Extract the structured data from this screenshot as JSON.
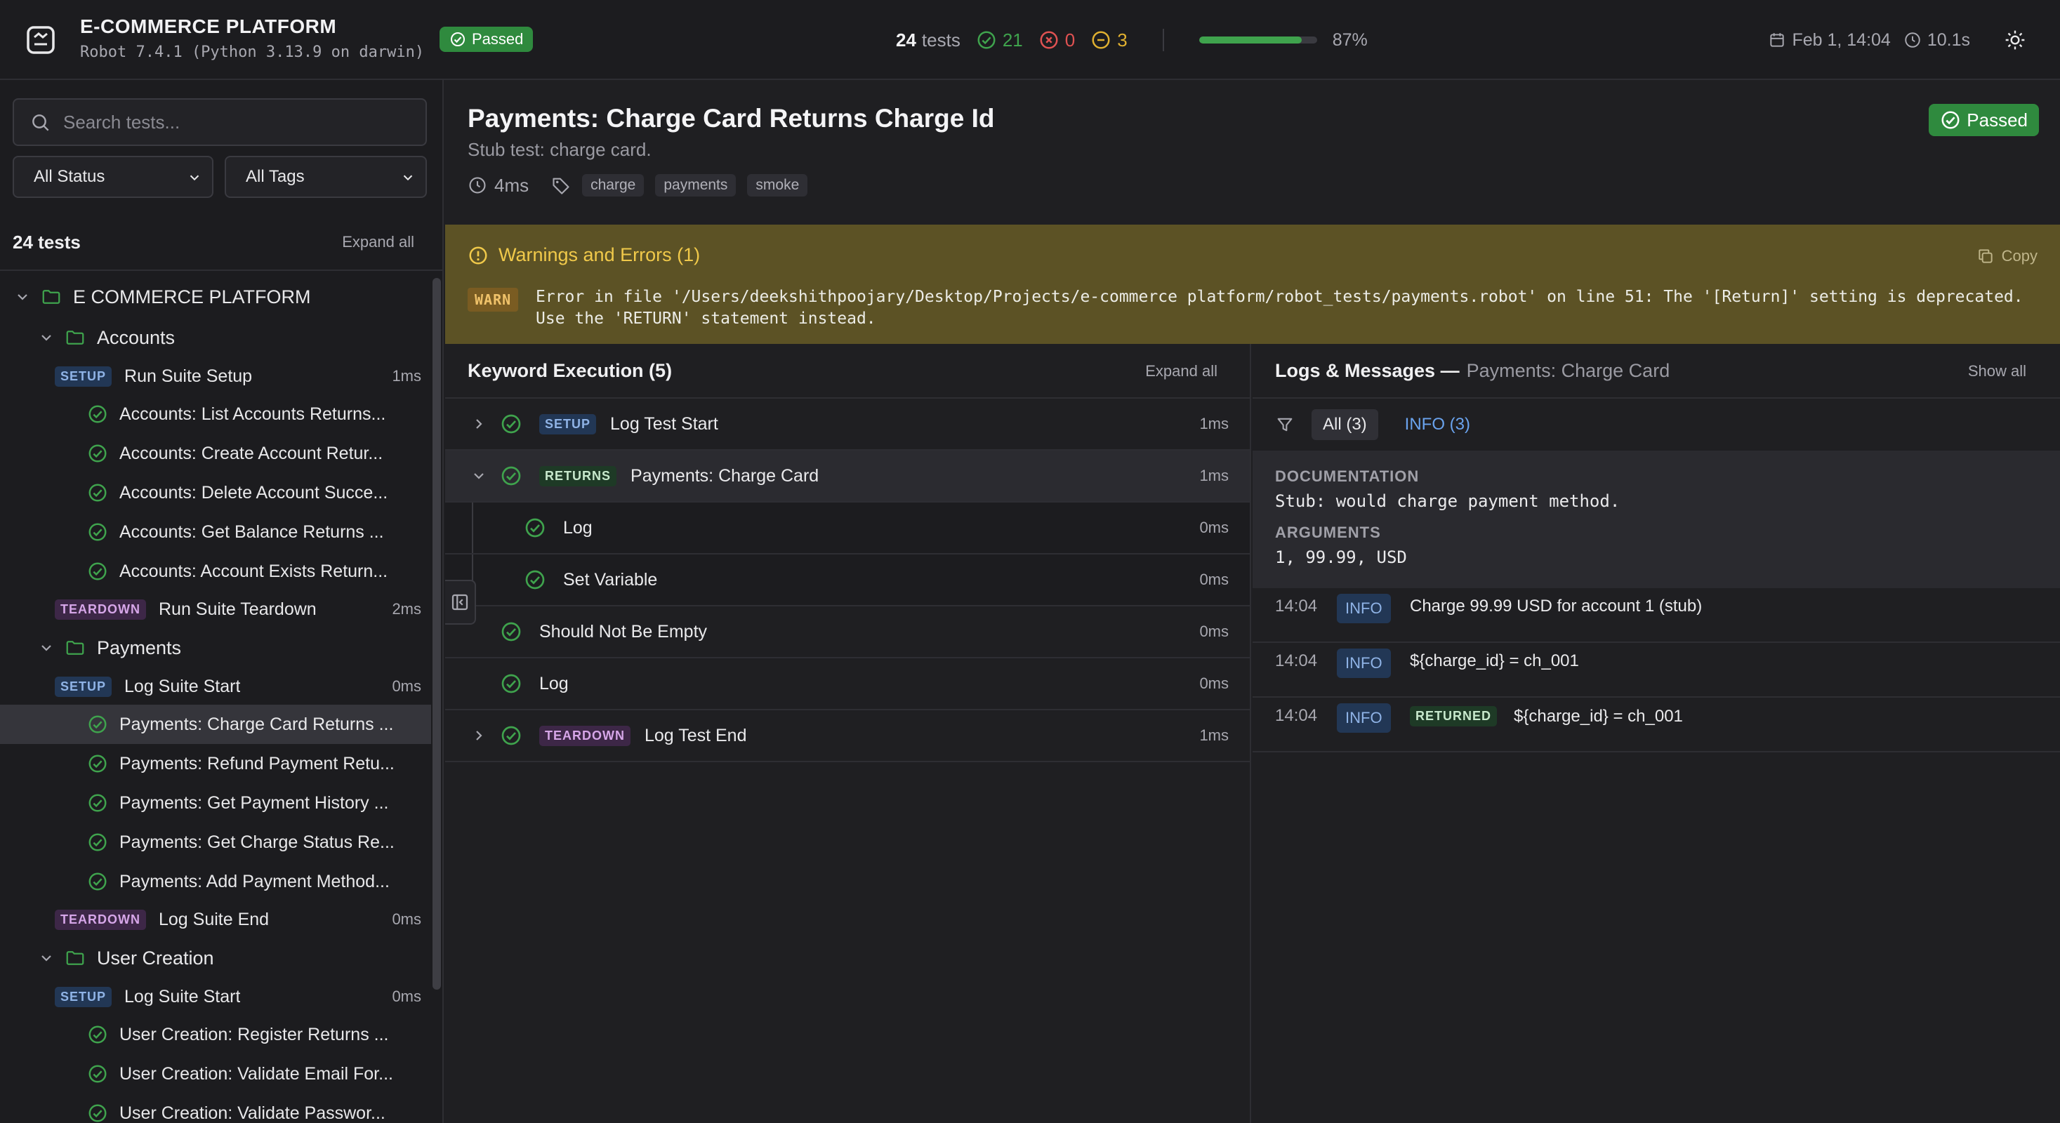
{
  "header": {
    "app_title": "E-COMMERCE PLATFORM",
    "app_subtitle": "Robot 7.4.1 (Python 3.13.9 on darwin)",
    "status": "Passed",
    "total_count": "24",
    "total_label": "tests",
    "passed": "21",
    "failed": "0",
    "skipped": "3",
    "progress_percent": 87,
    "progress_label": "87%",
    "date": "Feb 1, 14:04",
    "duration": "10.1s",
    "icons": [
      "dashboard-logo-icon",
      "check-circle-icon",
      "x-circle-icon",
      "minus-circle-icon",
      "calendar-icon",
      "clock-icon",
      "sun-icon"
    ]
  },
  "sidebar": {
    "search_placeholder": "Search tests...",
    "status_filter": "All Status",
    "tags_filter": "All Tags",
    "count_label": "24 tests",
    "expand_all": "Expand all",
    "tree": [
      {
        "kind": "suite",
        "level": 0,
        "label": "E COMMERCE PLATFORM"
      },
      {
        "kind": "suite",
        "level": 1,
        "label": "Accounts"
      },
      {
        "kind": "setup",
        "level": 2,
        "label": "Run Suite Setup",
        "duration": "1ms"
      },
      {
        "kind": "test",
        "level": 2,
        "label": "Accounts: List Accounts Returns..."
      },
      {
        "kind": "test",
        "level": 2,
        "label": "Accounts: Create Account Retur..."
      },
      {
        "kind": "test",
        "level": 2,
        "label": "Accounts: Delete Account Succe..."
      },
      {
        "kind": "test",
        "level": 2,
        "label": "Accounts: Get Balance Returns ..."
      },
      {
        "kind": "test",
        "level": 2,
        "label": "Accounts: Account Exists Return..."
      },
      {
        "kind": "teardown",
        "level": 2,
        "label": "Run Suite Teardown",
        "duration": "2ms"
      },
      {
        "kind": "suite",
        "level": 1,
        "label": "Payments"
      },
      {
        "kind": "setup",
        "level": 2,
        "label": "Log Suite Start",
        "duration": "0ms"
      },
      {
        "kind": "test",
        "level": 2,
        "label": "Payments: Charge Card Returns ...",
        "selected": true
      },
      {
        "kind": "test",
        "level": 2,
        "label": "Payments: Refund Payment Retu..."
      },
      {
        "kind": "test",
        "level": 2,
        "label": "Payments: Get Payment History ..."
      },
      {
        "kind": "test",
        "level": 2,
        "label": "Payments: Get Charge Status Re..."
      },
      {
        "kind": "test",
        "level": 2,
        "label": "Payments: Add Payment Method..."
      },
      {
        "kind": "teardown",
        "level": 2,
        "label": "Log Suite End",
        "duration": "0ms"
      },
      {
        "kind": "suite",
        "level": 1,
        "label": "User Creation"
      },
      {
        "kind": "setup",
        "level": 2,
        "label": "Log Suite Start",
        "duration": "0ms"
      },
      {
        "kind": "test",
        "level": 2,
        "label": "User Creation: Register Returns ..."
      },
      {
        "kind": "test",
        "level": 2,
        "label": "User Creation: Validate Email For..."
      },
      {
        "kind": "test",
        "level": 2,
        "label": "User Creation: Validate Passwor..."
      }
    ],
    "badges": {
      "setup": "SETUP",
      "teardown": "TEARDOWN"
    }
  },
  "main": {
    "title": "Payments: Charge Card Returns Charge Id",
    "subtitle": "Stub test: charge card.",
    "status": "Passed",
    "duration": "4ms",
    "tags": [
      "charge",
      "payments",
      "smoke"
    ],
    "warnings": {
      "title": "Warnings and Errors (1)",
      "copy_label": "Copy",
      "level": "WARN",
      "message": "Error in file '/Users/deekshithpoojary/Desktop/Projects/e-commerce platform/robot_tests/payments.robot' on line 51: The '[Return]' setting is deprecated. Use the 'RETURN' statement instead."
    },
    "keywords": {
      "title": "Keyword Execution (5)",
      "expand_all": "Expand all",
      "rows": [
        {
          "badge": "SETUP",
          "badge_kind": "setup",
          "name": "Log Test Start",
          "duration": "1ms",
          "chevron": "right",
          "depth": 0
        },
        {
          "badge": "RETURNS",
          "badge_kind": "returns",
          "name": "Payments: Charge Card",
          "duration": "1ms",
          "chevron": "down",
          "depth": 0,
          "active": true
        },
        {
          "badge": "",
          "badge_kind": "",
          "name": "Log",
          "duration": "0ms",
          "chevron": "",
          "depth": 1
        },
        {
          "badge": "",
          "badge_kind": "",
          "name": "Set Variable",
          "duration": "0ms",
          "chevron": "",
          "depth": 1
        },
        {
          "badge": "",
          "badge_kind": "",
          "name": "Should Not Be Empty",
          "duration": "0ms",
          "chevron": "",
          "depth": 0
        },
        {
          "badge": "",
          "badge_kind": "",
          "name": "Log",
          "duration": "0ms",
          "chevron": "",
          "depth": 0
        },
        {
          "badge": "TEARDOWN",
          "badge_kind": "teardown",
          "name": "Log Test End",
          "duration": "1ms",
          "chevron": "right",
          "depth": 0
        }
      ]
    },
    "logs": {
      "title": "Logs & Messages —",
      "context": "Payments: Charge Card",
      "show_all": "Show all",
      "filter_all": "All (3)",
      "filter_info": "INFO (3)",
      "doc_heading": "DOCUMENTATION",
      "doc_text": "Stub: would charge payment method.",
      "args_heading": "ARGUMENTS",
      "args_text": "1, 99.99, USD",
      "entries": [
        {
          "time": "14:04",
          "level": "INFO",
          "returned": "",
          "message": "Charge 99.99 USD for account 1 (stub)"
        },
        {
          "time": "14:04",
          "level": "INFO",
          "returned": "",
          "message": "${charge_id} = ch_001"
        },
        {
          "time": "14:04",
          "level": "INFO",
          "returned": "RETURNED",
          "message": "${charge_id} = ch_001"
        }
      ]
    }
  },
  "colors": {
    "pass": "#3fa34d",
    "fail": "#e05252",
    "skip": "#e0b030",
    "accent": "#6aa3ee",
    "warn_bg": "#5c5225"
  }
}
